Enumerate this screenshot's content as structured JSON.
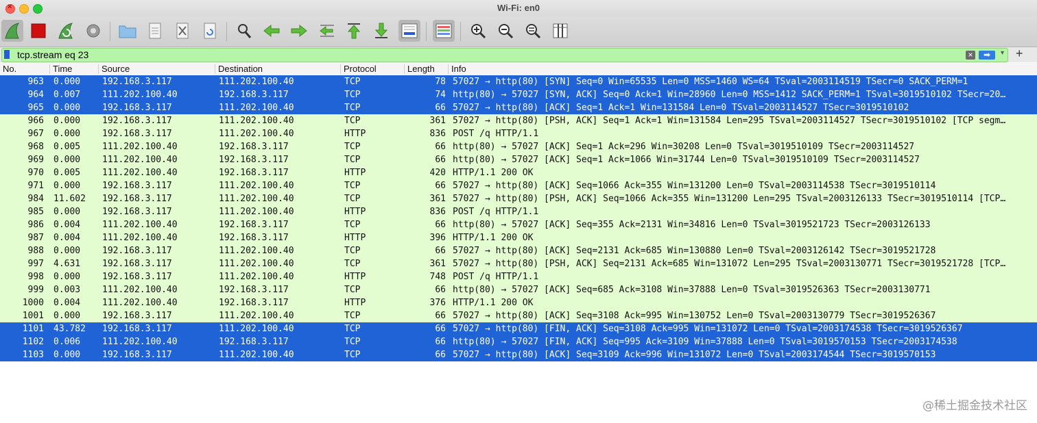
{
  "window": {
    "title": "Wi-Fi: en0"
  },
  "toolbar": {
    "icons": [
      "shark-fin-start-icon",
      "stop-square-icon",
      "restart-capture-icon",
      "capture-options-gear-icon",
      "open-folder-icon",
      "save-file-icon",
      "close-file-icon",
      "reload-file-icon",
      "find-packet-icon",
      "go-back-icon",
      "go-forward-icon",
      "go-to-packet-icon",
      "go-first-icon",
      "go-last-icon",
      "auto-scroll-icon",
      "colorize-icon",
      "zoom-in-icon",
      "zoom-out-icon",
      "normal-size-icon",
      "resize-columns-icon"
    ]
  },
  "filter": {
    "value": "tcp.stream eq 23",
    "clear_icon": "×",
    "apply_icon": "➡",
    "dropdown_icon": "▾",
    "add_icon": "+"
  },
  "columns": {
    "no": "No.",
    "time": "Time",
    "source": "Source",
    "destination": "Destination",
    "protocol": "Protocol",
    "length": "Length",
    "info": "Info"
  },
  "packets": [
    {
      "no": "963",
      "time": "0.000",
      "src": "192.168.3.117",
      "dst": "111.202.100.40",
      "proto": "TCP",
      "len": "78",
      "info": "57027 → http(80) [SYN] Seq=0 Win=65535 Len=0 MSS=1460 WS=64 TSval=2003114519 TSecr=0 SACK_PERM=1",
      "selected": true
    },
    {
      "no": "964",
      "time": "0.007",
      "src": "111.202.100.40",
      "dst": "192.168.3.117",
      "proto": "TCP",
      "len": "74",
      "info": "http(80) → 57027 [SYN, ACK] Seq=0 Ack=1 Win=28960 Len=0 MSS=1412 SACK_PERM=1 TSval=3019510102 TSecr=20…",
      "selected": true
    },
    {
      "no": "965",
      "time": "0.000",
      "src": "192.168.3.117",
      "dst": "111.202.100.40",
      "proto": "TCP",
      "len": "66",
      "info": "57027 → http(80) [ACK] Seq=1 Ack=1 Win=131584 Len=0 TSval=2003114527 TSecr=3019510102",
      "selected": true
    },
    {
      "no": "966",
      "time": "0.000",
      "src": "192.168.3.117",
      "dst": "111.202.100.40",
      "proto": "TCP",
      "len": "361",
      "info": "57027 → http(80) [PSH, ACK] Seq=1 Ack=1 Win=131584 Len=295 TSval=2003114527 TSecr=3019510102 [TCP segm…",
      "selected": false
    },
    {
      "no": "967",
      "time": "0.000",
      "src": "192.168.3.117",
      "dst": "111.202.100.40",
      "proto": "HTTP",
      "len": "836",
      "info": "POST /q HTTP/1.1",
      "selected": false
    },
    {
      "no": "968",
      "time": "0.005",
      "src": "111.202.100.40",
      "dst": "192.168.3.117",
      "proto": "TCP",
      "len": "66",
      "info": "http(80) → 57027 [ACK] Seq=1 Ack=296 Win=30208 Len=0 TSval=3019510109 TSecr=2003114527",
      "selected": false
    },
    {
      "no": "969",
      "time": "0.000",
      "src": "111.202.100.40",
      "dst": "192.168.3.117",
      "proto": "TCP",
      "len": "66",
      "info": "http(80) → 57027 [ACK] Seq=1 Ack=1066 Win=31744 Len=0 TSval=3019510109 TSecr=2003114527",
      "selected": false
    },
    {
      "no": "970",
      "time": "0.005",
      "src": "111.202.100.40",
      "dst": "192.168.3.117",
      "proto": "HTTP",
      "len": "420",
      "info": "HTTP/1.1 200 OK",
      "selected": false
    },
    {
      "no": "971",
      "time": "0.000",
      "src": "192.168.3.117",
      "dst": "111.202.100.40",
      "proto": "TCP",
      "len": "66",
      "info": "57027 → http(80) [ACK] Seq=1066 Ack=355 Win=131200 Len=0 TSval=2003114538 TSecr=3019510114",
      "selected": false
    },
    {
      "no": "984",
      "time": "11.602",
      "src": "192.168.3.117",
      "dst": "111.202.100.40",
      "proto": "TCP",
      "len": "361",
      "info": "57027 → http(80) [PSH, ACK] Seq=1066 Ack=355 Win=131200 Len=295 TSval=2003126133 TSecr=3019510114 [TCP…",
      "selected": false
    },
    {
      "no": "985",
      "time": "0.000",
      "src": "192.168.3.117",
      "dst": "111.202.100.40",
      "proto": "HTTP",
      "len": "836",
      "info": "POST /q HTTP/1.1",
      "selected": false
    },
    {
      "no": "986",
      "time": "0.004",
      "src": "111.202.100.40",
      "dst": "192.168.3.117",
      "proto": "TCP",
      "len": "66",
      "info": "http(80) → 57027 [ACK] Seq=355 Ack=2131 Win=34816 Len=0 TSval=3019521723 TSecr=2003126133",
      "selected": false
    },
    {
      "no": "987",
      "time": "0.004",
      "src": "111.202.100.40",
      "dst": "192.168.3.117",
      "proto": "HTTP",
      "len": "396",
      "info": "HTTP/1.1 200 OK",
      "selected": false
    },
    {
      "no": "988",
      "time": "0.000",
      "src": "192.168.3.117",
      "dst": "111.202.100.40",
      "proto": "TCP",
      "len": "66",
      "info": "57027 → http(80) [ACK] Seq=2131 Ack=685 Win=130880 Len=0 TSval=2003126142 TSecr=3019521728",
      "selected": false
    },
    {
      "no": "997",
      "time": "4.631",
      "src": "192.168.3.117",
      "dst": "111.202.100.40",
      "proto": "TCP",
      "len": "361",
      "info": "57027 → http(80) [PSH, ACK] Seq=2131 Ack=685 Win=131072 Len=295 TSval=2003130771 TSecr=3019521728 [TCP…",
      "selected": false
    },
    {
      "no": "998",
      "time": "0.000",
      "src": "192.168.3.117",
      "dst": "111.202.100.40",
      "proto": "HTTP",
      "len": "748",
      "info": "POST /q HTTP/1.1",
      "selected": false
    },
    {
      "no": "999",
      "time": "0.003",
      "src": "111.202.100.40",
      "dst": "192.168.3.117",
      "proto": "TCP",
      "len": "66",
      "info": "http(80) → 57027 [ACK] Seq=685 Ack=3108 Win=37888 Len=0 TSval=3019526363 TSecr=2003130771",
      "selected": false
    },
    {
      "no": "1000",
      "time": "0.004",
      "src": "111.202.100.40",
      "dst": "192.168.3.117",
      "proto": "HTTP",
      "len": "376",
      "info": "HTTP/1.1 200 OK",
      "selected": false
    },
    {
      "no": "1001",
      "time": "0.000",
      "src": "192.168.3.117",
      "dst": "111.202.100.40",
      "proto": "TCP",
      "len": "66",
      "info": "57027 → http(80) [ACK] Seq=3108 Ack=995 Win=130752 Len=0 TSval=2003130779 TSecr=3019526367",
      "selected": false
    },
    {
      "no": "1101",
      "time": "43.782",
      "src": "192.168.3.117",
      "dst": "111.202.100.40",
      "proto": "TCP",
      "len": "66",
      "info": "57027 → http(80) [FIN, ACK] Seq=3108 Ack=995 Win=131072 Len=0 TSval=2003174538 TSecr=3019526367",
      "selected": true
    },
    {
      "no": "1102",
      "time": "0.006",
      "src": "111.202.100.40",
      "dst": "192.168.3.117",
      "proto": "TCP",
      "len": "66",
      "info": "http(80) → 57027 [FIN, ACK] Seq=995 Ack=3109 Win=37888 Len=0 TSval=3019570153 TSecr=2003174538",
      "selected": true
    },
    {
      "no": "1103",
      "time": "0.000",
      "src": "192.168.3.117",
      "dst": "111.202.100.40",
      "proto": "TCP",
      "len": "66",
      "info": "57027 → http(80) [ACK] Seq=3109 Ack=996 Win=131072 Len=0 TSval=2003174544 TSecr=3019570153",
      "selected": true
    }
  ],
  "watermark": "@稀土掘金技术社区",
  "colors": {
    "selected_row": "#1f63d6",
    "tcp_row": "#e4fdd0",
    "filter_valid": "#b6f5a8"
  }
}
